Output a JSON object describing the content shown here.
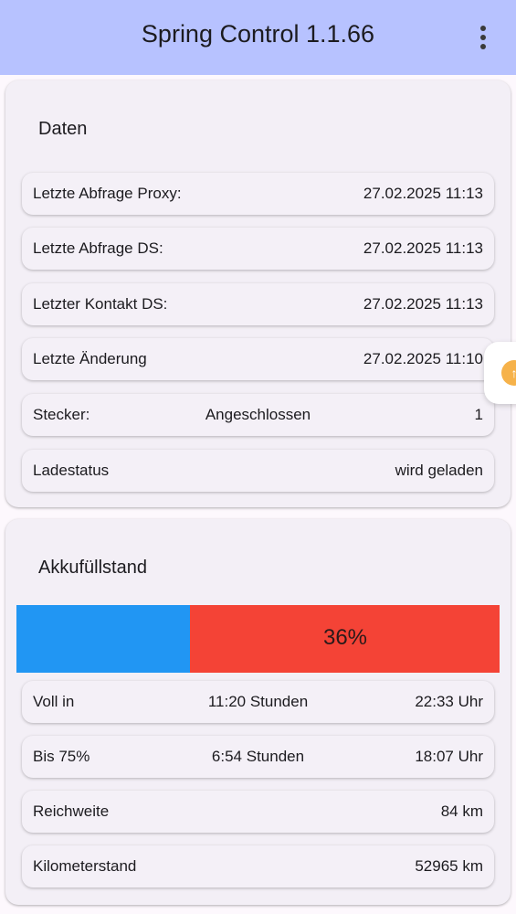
{
  "appbar": {
    "title": "Spring Control 1.1.66",
    "menu_icon": "more-vert-icon"
  },
  "daten": {
    "title": "Daten",
    "rows": [
      {
        "label": "Letzte Abfrage Proxy:",
        "center": "",
        "value": "27.02.2025 11:13"
      },
      {
        "label": "Letzte Abfrage DS:",
        "center": "",
        "value": "27.02.2025 11:13"
      },
      {
        "label": "Letzter Kontakt DS:",
        "center": "",
        "value": "27.02.2025 11:13"
      },
      {
        "label": "Letzte Änderung",
        "center": "",
        "value": "27.02.2025 11:10"
      },
      {
        "label": "Stecker:",
        "center": "Angeschlossen",
        "value": "1"
      },
      {
        "label": "Ladestatus",
        "center": "",
        "value": "wird geladen"
      }
    ]
  },
  "akku": {
    "title": "Akkufüllstand",
    "battery": {
      "percent_label": "36%",
      "fill_fraction": 0.36,
      "fill_color": "#2196f3",
      "rest_color": "#f44336"
    },
    "rows": [
      {
        "label": "Voll in",
        "center": "11:20 Stunden",
        "value": "22:33 Uhr"
      },
      {
        "label": "Bis 75%",
        "center": "6:54 Stunden",
        "value": "18:07 Uhr"
      },
      {
        "label": "Reichweite",
        "center": "",
        "value": "84 km"
      },
      {
        "label": "Kilometerstand",
        "center": "",
        "value": "52965 km"
      }
    ]
  },
  "floating_button": {
    "icon": "upload-icon",
    "color": "#f6b24a"
  }
}
